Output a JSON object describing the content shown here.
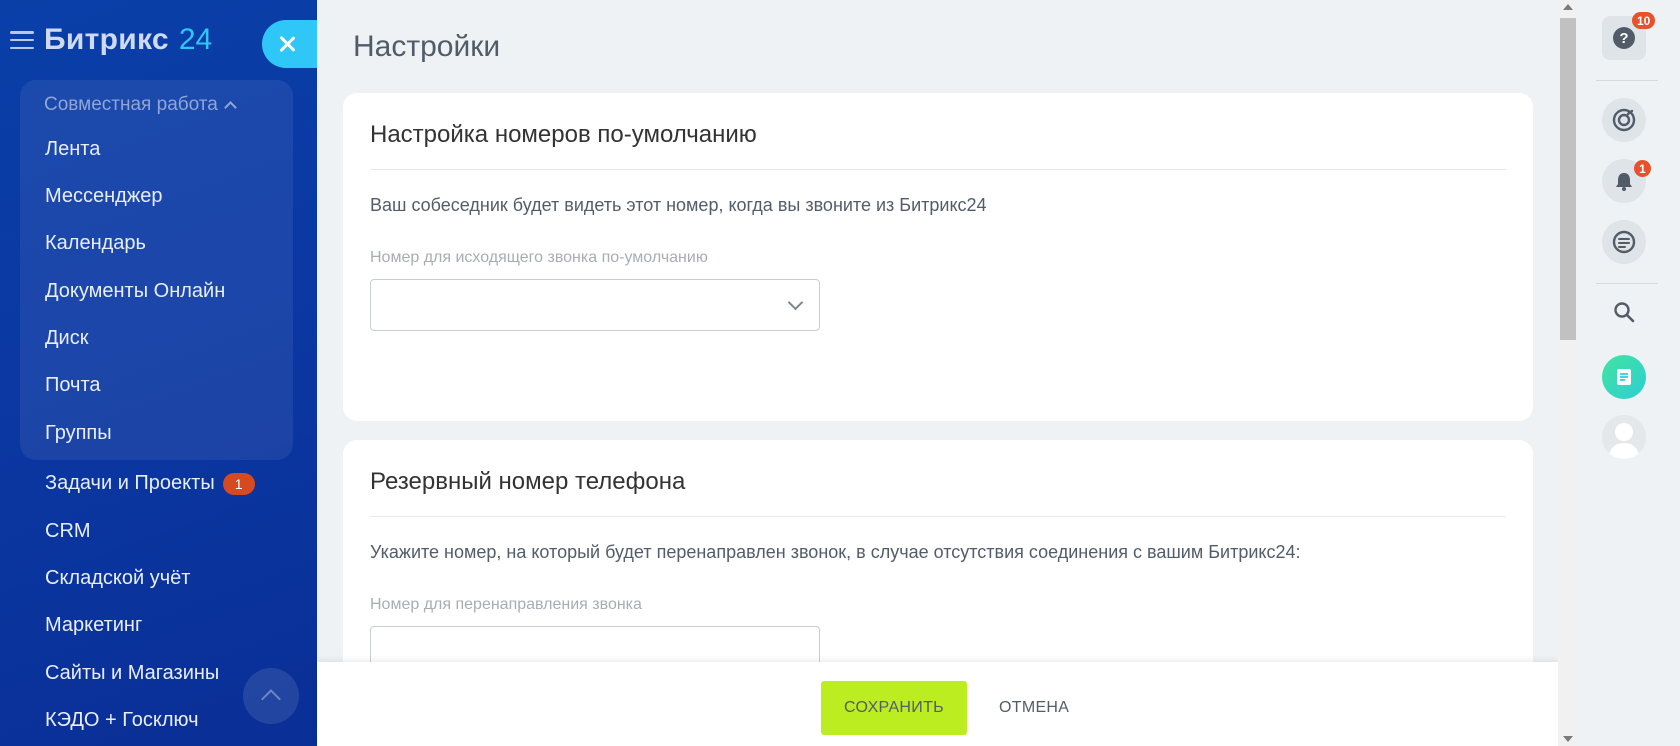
{
  "sidebar": {
    "logo_text": "Битрикс",
    "logo_number": "24",
    "group_title": "Совместная работа",
    "group_items": [
      {
        "label": "Лента"
      },
      {
        "label": "Мессенджер"
      },
      {
        "label": "Календарь"
      },
      {
        "label": "Документы Онлайн"
      },
      {
        "label": "Диск"
      },
      {
        "label": "Почта"
      },
      {
        "label": "Группы"
      }
    ],
    "items": [
      {
        "label": "Задачи и Проекты",
        "badge": "1"
      },
      {
        "label": "CRM"
      },
      {
        "label": "Складской учёт"
      },
      {
        "label": "Маркетинг"
      },
      {
        "label": "Сайты и Магазины"
      },
      {
        "label": "КЭДО + Госключ"
      }
    ]
  },
  "main": {
    "page_title": "Настройки",
    "cards": [
      {
        "title": "Настройка номеров по-умолчанию",
        "description": "Ваш собеседник будет видеть этот номер, когда вы звоните из Битрикс24",
        "field_label": "Номер для исходящего звонка по-умолчанию",
        "field_value": ""
      },
      {
        "title": "Резервный номер телефона",
        "description": "Укажите номер, на который будет перенаправлен звонок, в случае отсутствия соединения с вашим Битрикс24:",
        "field_label": "Номер для перенаправления звонка",
        "field_value": ""
      }
    ]
  },
  "actions": {
    "save_label": "СОХРАНИТЬ",
    "cancel_label": "ОТМЕНА"
  },
  "right_panel": {
    "help_badge": "10",
    "notifications_badge": "1",
    "help_symbol": "?"
  },
  "colors": {
    "sidebar_bg": "#0a3fa8",
    "accent_blue": "#2fc7f7",
    "save_green": "#bbed21",
    "badge_red": "#e8512a"
  }
}
